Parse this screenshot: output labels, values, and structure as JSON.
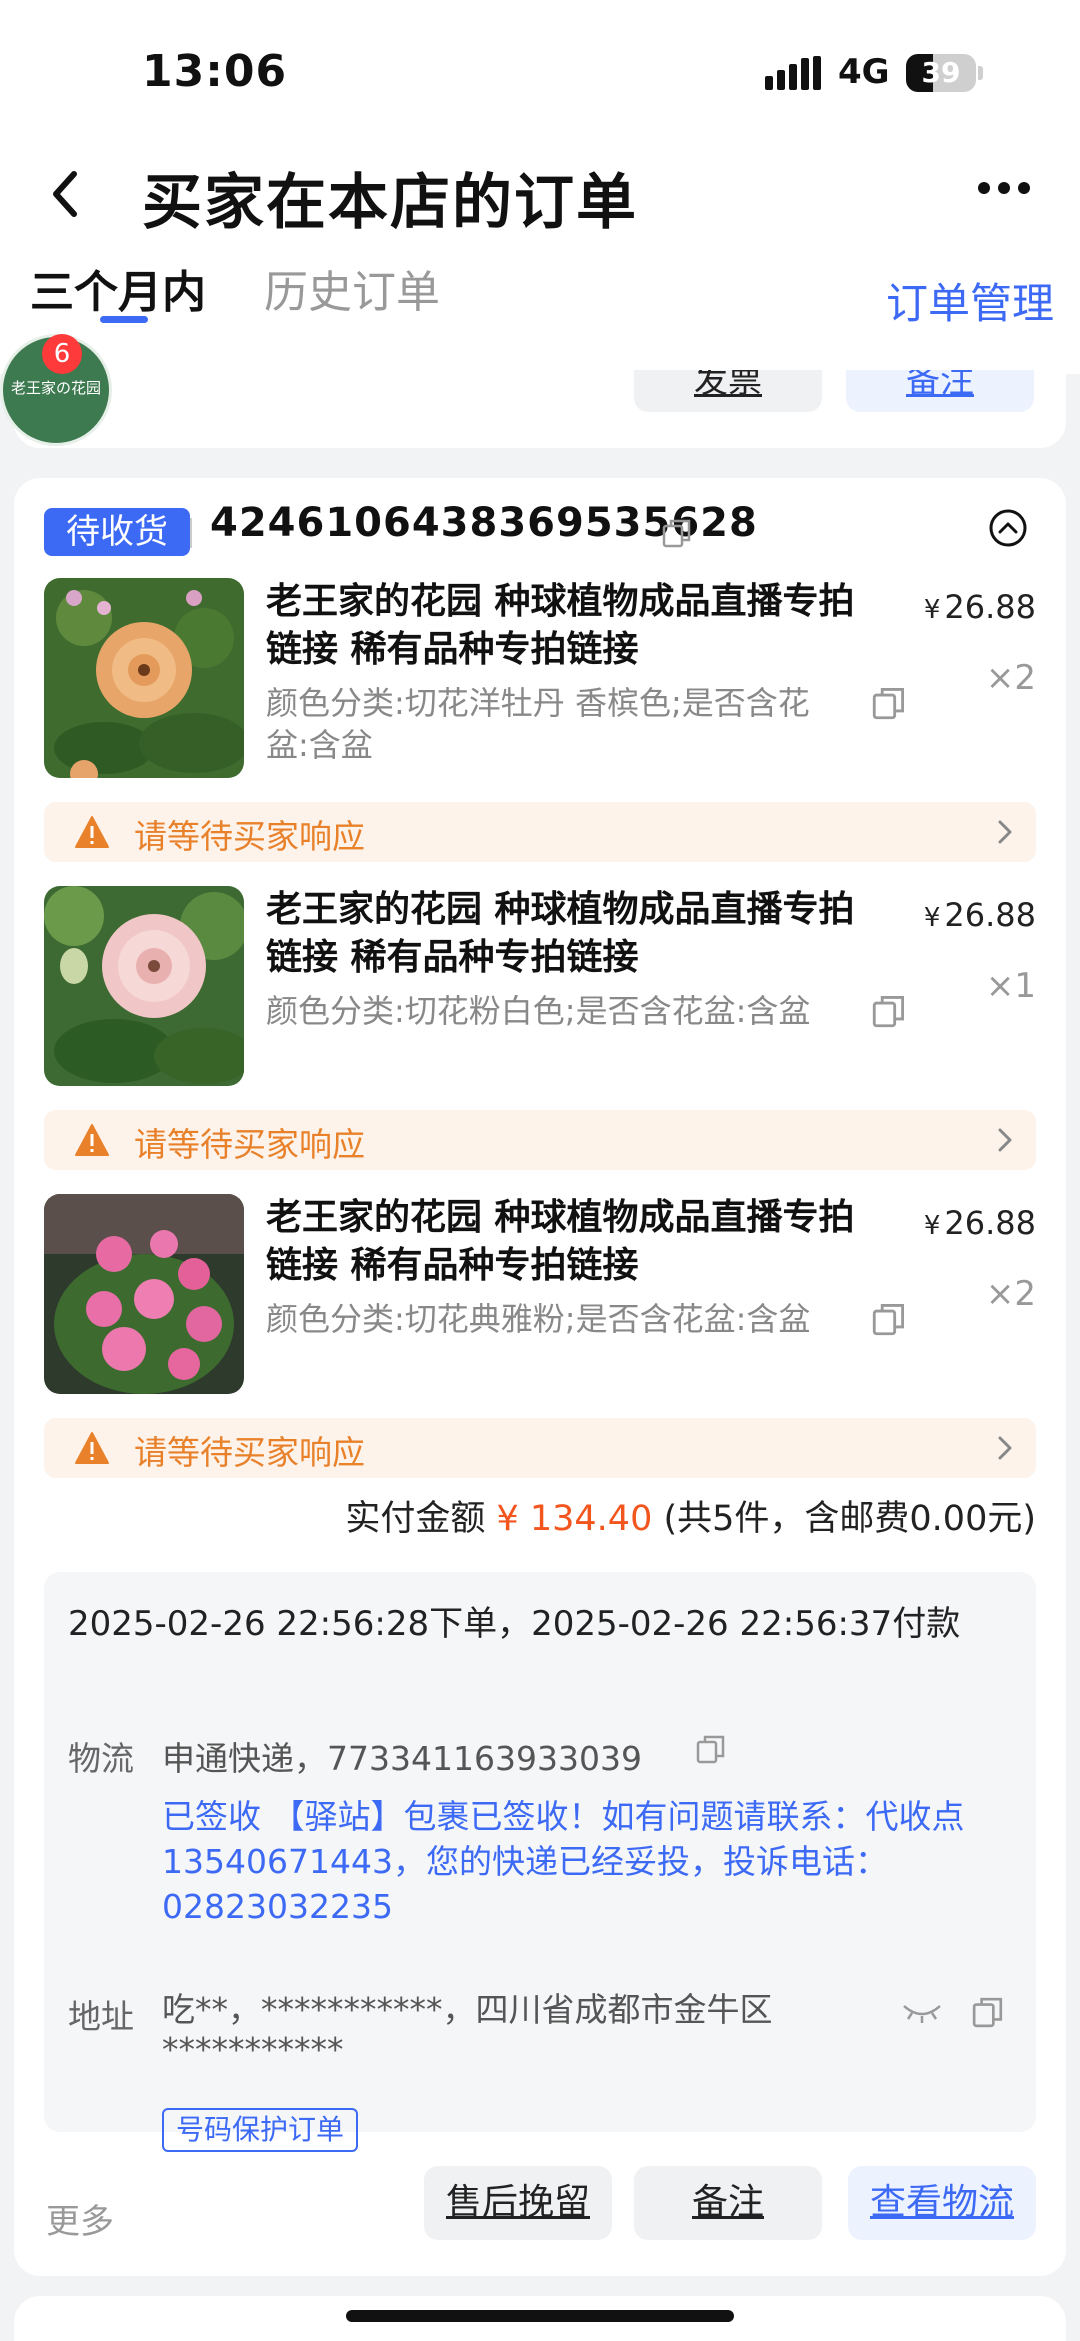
{
  "status_bar": {
    "time": "13:06",
    "network": "4G",
    "battery": "39",
    "battery_level": 0.39
  },
  "nav": {
    "title": "买家在本店的订单",
    "back_icon": "chevron-left-icon",
    "more_icon": "more-dots-icon"
  },
  "tabs": {
    "active": "三个月内",
    "history": "历史订单",
    "manage": "订单管理"
  },
  "avatar": {
    "badge": "6",
    "text": "老王家の花园"
  },
  "prev_card": {
    "btn_a": "发票",
    "btn_b": "备注"
  },
  "order": {
    "status": "待收货",
    "order_no": "4246106438369535628",
    "items": [
      {
        "title": "老王家的花园 种球植物成品直播专拍链接 稀有品种专拍链接",
        "attr": "颜色分类:切花洋牡丹 香槟色;是否含花盆:含盆",
        "price": "26.88",
        "qty": "×2"
      },
      {
        "title": "老王家的花园 种球植物成品直播专拍链接 稀有品种专拍链接",
        "attr": "颜色分类:切花粉白色;是否含花盆:含盆",
        "price": "26.88",
        "qty": "×1"
      },
      {
        "title": "老王家的花园 种球植物成品直播专拍链接 稀有品种专拍链接",
        "attr": "颜色分类:切花典雅粉;是否含花盆:含盆",
        "price": "26.88",
        "qty": "×2"
      }
    ],
    "currency": "¥",
    "notice": "请等待买家响应",
    "total_label": "实付金额",
    "total_amount": "¥ 134.40",
    "total_suffix": "(共5件，含邮费0.00元)",
    "detail": {
      "time_line": "2025-02-26 22:56:28下单，2025-02-26 22:56:37付款",
      "logistics_label": "物流",
      "logistics": "申通快递，773341163933039",
      "logistics_status": "已签收 【驿站】包裹已签收！如有问题请联系：代收点13540671443，您的快递已经妥投，投诉电话：02823032235",
      "address_label": "地址",
      "address": "吃**，***********，四川省成都市金牛区 ***********",
      "protect_tag": "号码保护订单"
    },
    "more": "更多",
    "buttons": {
      "aftersale": "售后挽留",
      "remark": "备注",
      "logistics": "查看物流"
    }
  },
  "colors": {
    "accent": "#3d6af5",
    "warning": "#e8812a",
    "price": "#f2551d"
  }
}
